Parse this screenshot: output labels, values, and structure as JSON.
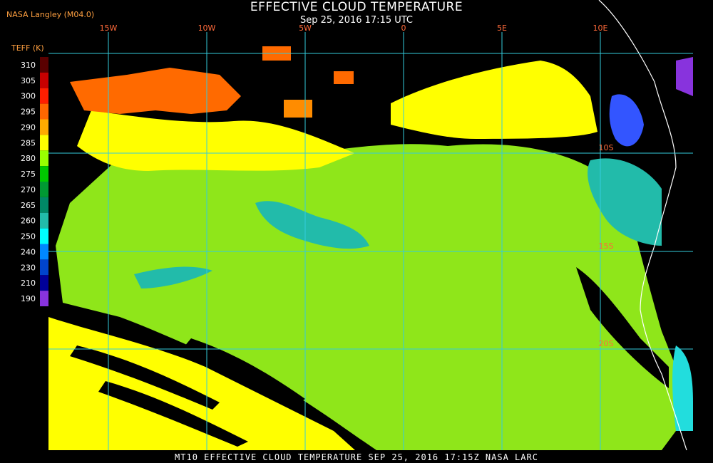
{
  "header": {
    "title": "EFFECTIVE CLOUD TEMPERATURE",
    "subtitle": "Sep 25, 2016 17:15 UTC",
    "agency": "NASA Langley (M04.0)"
  },
  "legend": {
    "title": "TEFF (K)",
    "items": [
      {
        "label": "310",
        "color": "#5a0000"
      },
      {
        "label": "305",
        "color": "#c80000"
      },
      {
        "label": "300",
        "color": "#ff1e00"
      },
      {
        "label": "295",
        "color": "#ff6600"
      },
      {
        "label": "290",
        "color": "#ffaa00"
      },
      {
        "label": "285",
        "color": "#ffff00"
      },
      {
        "label": "280",
        "color": "#99ff00"
      },
      {
        "label": "275",
        "color": "#00c800"
      },
      {
        "label": "270",
        "color": "#009933"
      },
      {
        "label": "265",
        "color": "#008866"
      },
      {
        "label": "260",
        "color": "#22bbaa"
      },
      {
        "label": "250",
        "color": "#00ffff"
      },
      {
        "label": "240",
        "color": "#0088ff"
      },
      {
        "label": "230",
        "color": "#0044cc"
      },
      {
        "label": "210",
        "color": "#000099"
      },
      {
        "label": "190",
        "color": "#8833dd"
      }
    ]
  },
  "map": {
    "longitude_labels": [
      "15W",
      "10W",
      "5W",
      "0",
      "5E",
      "10E"
    ],
    "latitude_labels": [
      "10S",
      "15S",
      "20S"
    ],
    "grid_color": "#33ccdd",
    "label_color": "#ff4400"
  },
  "footer": {
    "text": "MT10  EFFECTIVE CLOUD TEMPERATURE   SEP 25, 2016 17:15Z   NASA LARC"
  }
}
